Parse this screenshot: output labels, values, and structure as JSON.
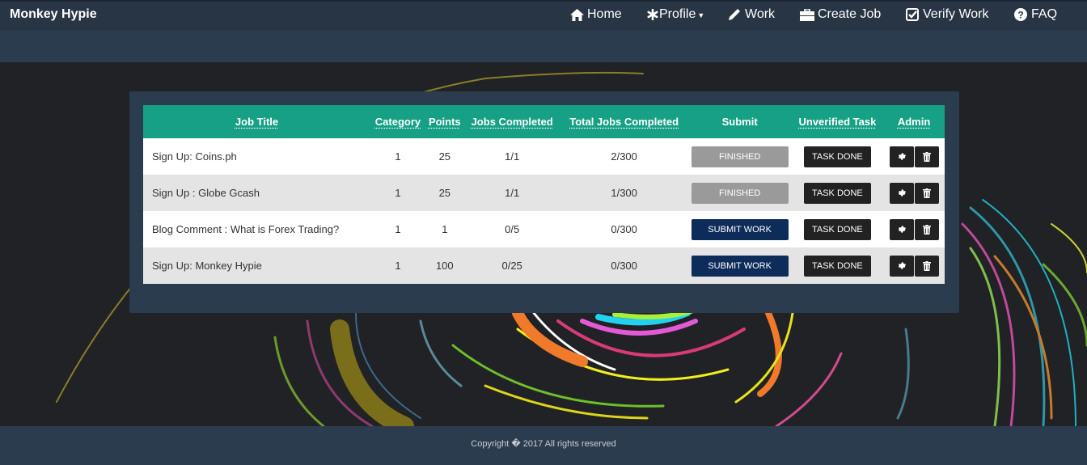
{
  "brand": "Monkey Hypie",
  "nav": [
    {
      "label": "Home",
      "icon": "home-icon"
    },
    {
      "label": "Profile",
      "icon": "asterisk-icon",
      "dropdown": true
    },
    {
      "label": "Work",
      "icon": "pencil-icon"
    },
    {
      "label": "Create Job",
      "icon": "briefcase-icon"
    },
    {
      "label": "Verify Work",
      "icon": "check-square-icon"
    },
    {
      "label": "FAQ",
      "icon": "question-circle-icon"
    }
  ],
  "table": {
    "headers": [
      "Job Title",
      "Category",
      "Points",
      "Jobs Completed",
      "Total Jobs Completed",
      "Submit",
      "Unverified Task",
      "Admin"
    ],
    "rows": [
      {
        "title": "Sign Up: Coins.ph",
        "category": "1",
        "points": "25",
        "jobs_completed": "1/1",
        "total_completed": "2/300",
        "submit_label": "FINISHED",
        "submit_state": "finished",
        "task_label": "TASK DONE"
      },
      {
        "title": "Sign Up : Globe Gcash",
        "category": "1",
        "points": "25",
        "jobs_completed": "1/1",
        "total_completed": "1/300",
        "submit_label": "FINISHED",
        "submit_state": "finished",
        "task_label": "TASK DONE"
      },
      {
        "title": "Blog Comment : What is Forex Trading?",
        "category": "1",
        "points": "1",
        "jobs_completed": "0/5",
        "total_completed": "0/300",
        "submit_label": "SUBMIT WORK",
        "submit_state": "submit",
        "task_label": "TASK DONE"
      },
      {
        "title": "Sign Up: Monkey Hypie",
        "category": "1",
        "points": "100",
        "jobs_completed": "0/25",
        "total_completed": "0/300",
        "submit_label": "SUBMIT WORK",
        "submit_state": "submit",
        "task_label": "TASK DONE"
      }
    ]
  },
  "footer": "Copyright � 2017 All rights reserved",
  "colors": {
    "header_bg": "#283544",
    "panel_bg": "#2c3c4f",
    "table_header": "#16a085",
    "submit_button": "#0d2c5a",
    "finished_button": "#9a9a9a",
    "dark_button": "#222222"
  }
}
